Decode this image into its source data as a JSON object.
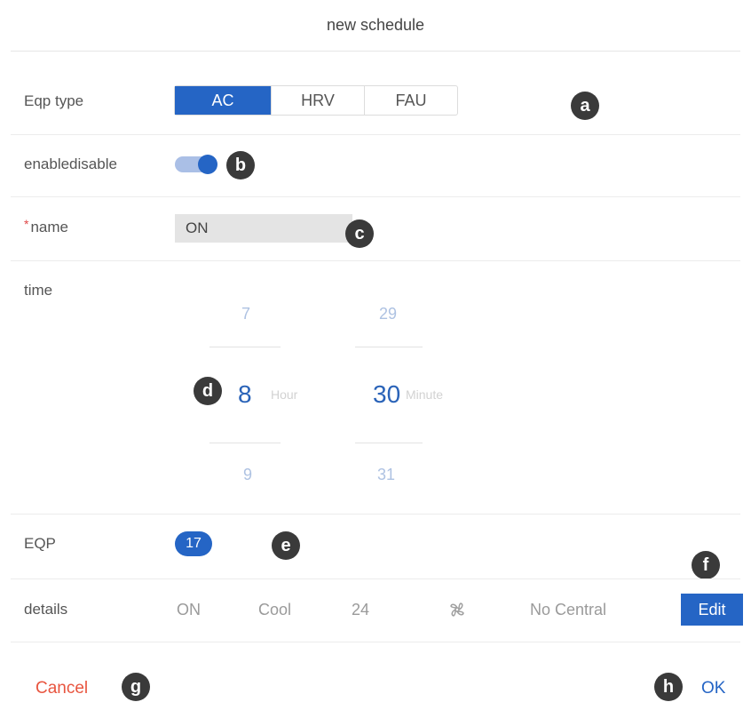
{
  "title": "new schedule",
  "eqp_type": {
    "label": "Eqp type",
    "options": [
      "AC",
      "HRV",
      "FAU"
    ],
    "selected": "AC"
  },
  "enable": {
    "label": "enabledisable",
    "on": true
  },
  "name": {
    "required_mark": "*",
    "label": "name",
    "value": "ON"
  },
  "time": {
    "label": "time",
    "hour": {
      "prev": "7",
      "selected": "8",
      "next": "9",
      "unit": "Hour"
    },
    "minute": {
      "prev": "29",
      "selected": "30",
      "next": "31",
      "unit": "Minute"
    }
  },
  "eqp": {
    "label": "EQP",
    "count": "17"
  },
  "details": {
    "label": "details",
    "power": "ON",
    "mode": "Cool",
    "temperature": "24",
    "fan_icon": "fan-icon",
    "central": "No Central",
    "edit_label": "Edit"
  },
  "footer": {
    "cancel_label": "Cancel",
    "ok_label": "OK"
  },
  "callouts": [
    "a",
    "b",
    "c",
    "d",
    "e",
    "f",
    "g",
    "h"
  ],
  "colors": {
    "accent": "#2565c5",
    "cancel": "#e8553f",
    "callout": "#3a3a3a"
  }
}
